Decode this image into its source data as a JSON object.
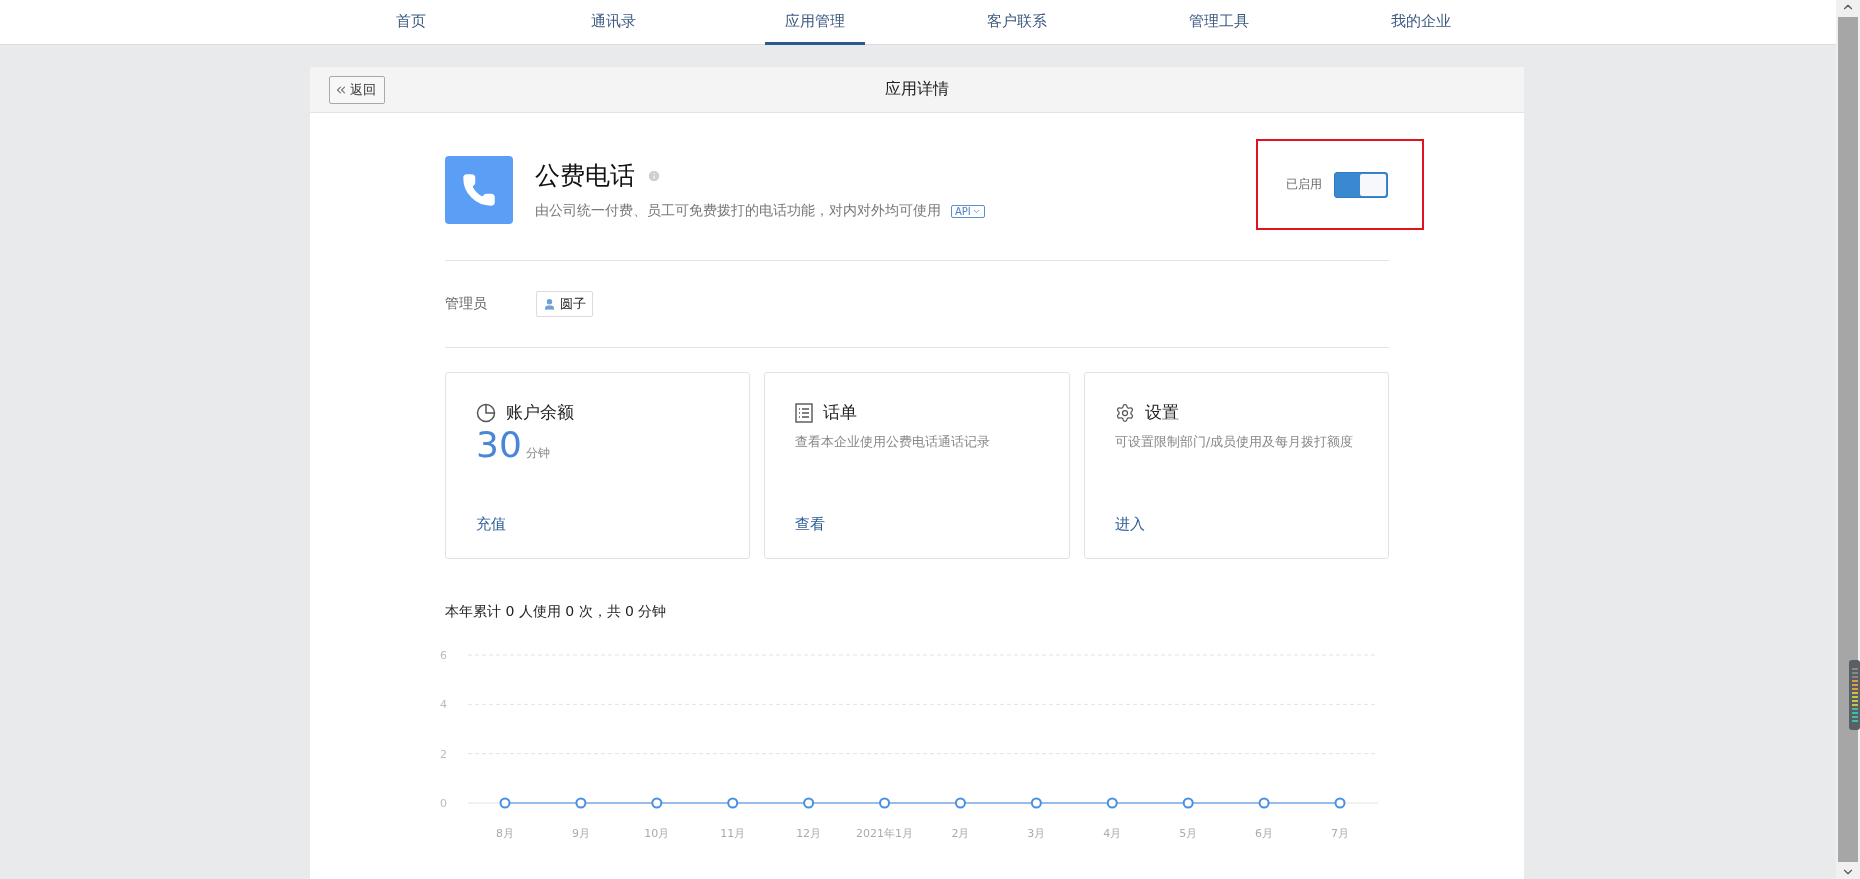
{
  "nav": {
    "tabs": [
      {
        "label": "首页",
        "selected": false
      },
      {
        "label": "通讯录",
        "selected": false
      },
      {
        "label": "应用管理",
        "selected": true
      },
      {
        "label": "客户联系",
        "selected": false
      },
      {
        "label": "管理工具",
        "selected": false
      },
      {
        "label": "我的企业",
        "selected": false
      }
    ]
  },
  "panel": {
    "back_button": "返回",
    "title": "应用详情"
  },
  "app": {
    "name": "公费电话",
    "description": "由公司统一付费、员工可免费拨打的电话功能，对内对外均可使用",
    "api_badge": "API",
    "status_label": "已启用",
    "enabled": true,
    "highlighted": true
  },
  "admin": {
    "label": "管理员",
    "name": "圆子"
  },
  "cards": [
    {
      "kind": "balance",
      "title": "账户余额",
      "value": "30",
      "unit": "分钟",
      "link": "充值"
    },
    {
      "kind": "records",
      "title": "话单",
      "description": "查看本企业使用公费电话通话记录",
      "link": "查看"
    },
    {
      "kind": "settings",
      "title": "设置",
      "description": "可设置限制部门/成员使用及每月拨打额度",
      "link": "进入"
    }
  ],
  "usage": {
    "summary": "本年累计 0 人使用 0 次，共 0 分钟",
    "chart_data": {
      "type": "line",
      "categories": [
        "8月",
        "9月",
        "10月",
        "11月",
        "12月",
        "2021年1月",
        "2月",
        "3月",
        "4月",
        "5月",
        "6月",
        "7月"
      ],
      "series": [
        {
          "color": "#4a90e2",
          "marker": "circle",
          "values": [
            0,
            0,
            0,
            0,
            0,
            0,
            0,
            0,
            0,
            0,
            0,
            0
          ]
        }
      ],
      "ylim": [
        0,
        6
      ],
      "yticks": [
        0,
        2,
        4,
        6
      ]
    }
  }
}
